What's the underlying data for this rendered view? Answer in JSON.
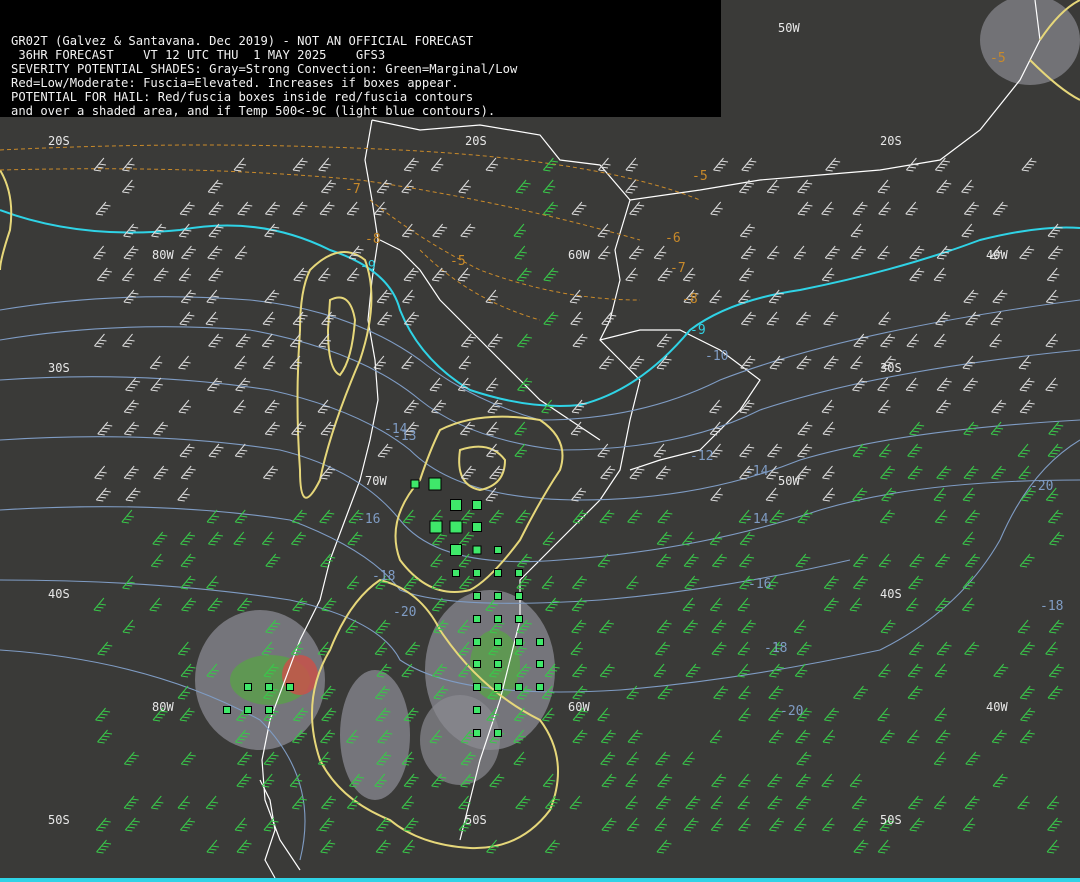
{
  "header": {
    "lines": [
      "GR02T (Galvez & Santavana. Dec 2019) - NOT AN OFFICIAL FORECAST",
      " 36HR FORECAST    VT 12 UTC THU  1 MAY 2025    GFS3",
      "SEVERITY POTENTIAL SHADES: Gray=Strong Convection: Green=Marginal/Low",
      "Red=Low/Moderate: Fuscia=Elevated. Increases if boxes appear.",
      "POTENTIAL FOR HAIL: Red/fuscia boxes inside red/fuscia contours",
      "and over a shaded area, and if Temp 500<-9C (light blue contours)."
    ]
  },
  "grid_labels": {
    "lat_20s_a": "20S",
    "lat_20s_b": "20S",
    "lat_20s_c": "20S",
    "lat_30s_a": "30S",
    "lat_30s_b": "30S",
    "lat_40s_a": "40S",
    "lat_40s_b": "40S",
    "lat_50s_a": "50S",
    "lat_50s_b": "50S",
    "lat_50s_c": "50S",
    "lon_80w_a": "80W",
    "lon_80w_b": "80W",
    "lon_70w_a": "70W",
    "lon_60w_a": "60W",
    "lon_60w_b": "60W",
    "lon_50w_a": "50W",
    "lon_50w_b": "50W",
    "lon_40w_a": "40W",
    "lon_40w_b": "40W"
  },
  "temp_labels": {
    "t_m9": "-9",
    "t_m10": "-10",
    "t_m12": "-12",
    "t_m14": "-14",
    "t_m13": "-13",
    "t_m16a": "-16",
    "t_m16b": "-16",
    "t_m18a": "-18",
    "t_m18b": "-18",
    "t_m20a": "-20",
    "t_m20b": "-20",
    "t_m20c": "-20",
    "t_m18c": "-18",
    "t_m14b": "-14",
    "t_m14c": "-14",
    "t_m9b": "-9"
  },
  "orange_labels": {
    "o_m5a": "-5",
    "o_m5b": "-5",
    "o_m6": "-6",
    "o_m7a": "-7",
    "o_m7b": "-7",
    "o_m8a": "-8",
    "o_m8b": "-8",
    "o_m5c": "-5"
  },
  "colors": {
    "background": "#3a3a38",
    "coastline": "#ffffff",
    "temp_contour": "#7f9cc4",
    "minus9_contour": "#2fd3e6",
    "yellow_contour": "#e6d77a",
    "orange_contour": "#c98a2a",
    "green_box": "#3fe86a",
    "shade_gray": "#8a8a92",
    "shade_green": "#5aa04a",
    "shade_red": "#c8524a",
    "wind_barb_green": "#39c84a",
    "wind_barb_white": "#dcdcdc"
  }
}
